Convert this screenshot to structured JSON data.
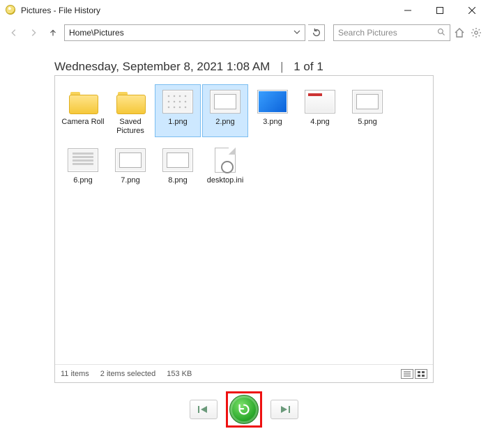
{
  "window": {
    "title": "Pictures - File History"
  },
  "nav": {
    "path": "Home\\Pictures",
    "search_placeholder": "Search Pictures"
  },
  "heading": {
    "timestamp": "Wednesday, September 8, 2021 1:08 AM",
    "position": "1 of 1"
  },
  "items": [
    {
      "name": "Camera Roll",
      "type": "folder",
      "selected": false
    },
    {
      "name": "Saved Pictures",
      "type": "folder",
      "selected": false
    },
    {
      "name": "1.png",
      "type": "image",
      "variant": "dots",
      "selected": true
    },
    {
      "name": "2.png",
      "type": "image",
      "variant": "win",
      "selected": true
    },
    {
      "name": "3.png",
      "type": "image",
      "variant": "blue",
      "selected": false
    },
    {
      "name": "4.png",
      "type": "image",
      "variant": "ui",
      "selected": false
    },
    {
      "name": "5.png",
      "type": "image",
      "variant": "win",
      "selected": false
    },
    {
      "name": "6.png",
      "type": "image",
      "variant": "doc",
      "selected": false
    },
    {
      "name": "7.png",
      "type": "image",
      "variant": "win",
      "selected": false
    },
    {
      "name": "8.png",
      "type": "image",
      "variant": "win",
      "selected": false
    },
    {
      "name": "desktop.ini",
      "type": "ini",
      "selected": false
    }
  ],
  "status": {
    "count": "11 items",
    "selection": "2 items selected",
    "size": "153 KB"
  }
}
